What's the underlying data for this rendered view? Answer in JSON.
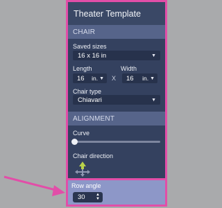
{
  "panel": {
    "title": "Theater Template"
  },
  "chair": {
    "section_label": "CHAIR",
    "saved_sizes_label": "Saved sizes",
    "saved_sizes_value": "16 x 16 in",
    "length_label": "Length",
    "length_value": "16",
    "length_unit": "in.",
    "times_label": "X",
    "width_label": "Width",
    "width_value": "16",
    "width_unit": "in.",
    "chair_type_label": "Chair type",
    "chair_type_value": "Chiavari"
  },
  "alignment": {
    "section_label": "ALIGNMENT",
    "curve_label": "Curve",
    "curve_value": 0,
    "chair_direction_label": "Chair direction",
    "row_angle_label": "Row angle",
    "row_angle_value": "30"
  },
  "colors": {
    "panel_bg": "#34415f",
    "section_bg": "#56648a",
    "highlight": "#e24ea8",
    "row_angle_bg": "#8d97c8",
    "direction_arrow": "#b9d24a"
  }
}
